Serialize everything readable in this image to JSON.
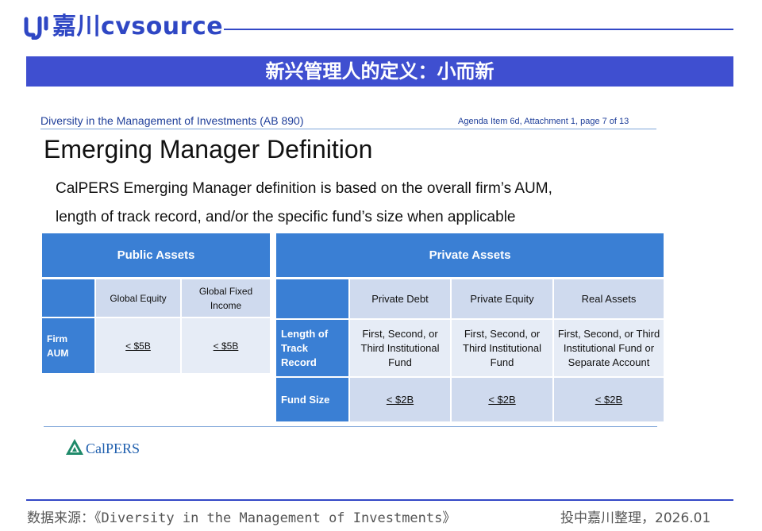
{
  "header": {
    "logo_text": "嘉川cvsource",
    "banner_title": "新兴管理人的定义：小而新"
  },
  "slide": {
    "subhead_left": "Diversity in the Management of Investments (AB 890)",
    "subhead_right": "Agenda Item 6d, Attachment 1, page 7 of 13",
    "title": "Emerging Manager Definition",
    "intro_line1": "CalPERS Emerging Manager definition is based on the overall firm’s AUM,",
    "intro_line2": "length of track record, and/or the specific fund’s size when applicable"
  },
  "public_table": {
    "header": "Public Assets",
    "columns": [
      "Global Equity",
      "Global Fixed Income"
    ],
    "row_label": "Firm AUM",
    "values": [
      "< $5B",
      "< $5B"
    ]
  },
  "private_table": {
    "header": "Private Assets",
    "columns": [
      "Private Debt",
      "Private Equity",
      "Real Assets"
    ],
    "rows": [
      {
        "label": "Length of Track Record",
        "values": [
          "First, Second, or Third Institutional Fund",
          "First, Second, or Third Institutional Fund",
          "First, Second, or Third Institutional Fund or Separate Account"
        ]
      },
      {
        "label": "Fund Size",
        "values": [
          "< $2B",
          "< $2B",
          "< $2B"
        ]
      }
    ]
  },
  "calpers": {
    "logo_text": "CalPERS",
    "accent": "#1f8a6a"
  },
  "footer": {
    "source": "数据来源：《Diversity in the Management of Investments》",
    "credit": "投中嘉川整理，2026.01"
  },
  "colors": {
    "brand": "#3348c6",
    "table_blue": "#3a7fd4",
    "table_light": "#cfdaee"
  }
}
